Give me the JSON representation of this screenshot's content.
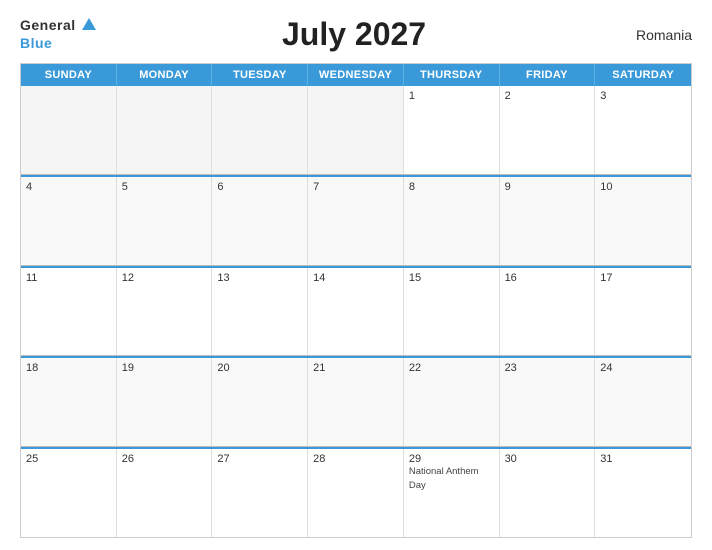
{
  "header": {
    "logo_general": "General",
    "logo_blue": "Blue",
    "title": "July 2027",
    "country": "Romania"
  },
  "calendar": {
    "days_of_week": [
      "Sunday",
      "Monday",
      "Tuesday",
      "Wednesday",
      "Thursday",
      "Friday",
      "Saturday"
    ],
    "weeks": [
      [
        {
          "day": "",
          "empty": true
        },
        {
          "day": "",
          "empty": true
        },
        {
          "day": "",
          "empty": true
        },
        {
          "day": "",
          "empty": true
        },
        {
          "day": "1",
          "empty": false,
          "event": ""
        },
        {
          "day": "2",
          "empty": false,
          "event": ""
        },
        {
          "day": "3",
          "empty": false,
          "event": ""
        }
      ],
      [
        {
          "day": "4",
          "empty": false,
          "event": ""
        },
        {
          "day": "5",
          "empty": false,
          "event": ""
        },
        {
          "day": "6",
          "empty": false,
          "event": ""
        },
        {
          "day": "7",
          "empty": false,
          "event": ""
        },
        {
          "day": "8",
          "empty": false,
          "event": ""
        },
        {
          "day": "9",
          "empty": false,
          "event": ""
        },
        {
          "day": "10",
          "empty": false,
          "event": ""
        }
      ],
      [
        {
          "day": "11",
          "empty": false,
          "event": ""
        },
        {
          "day": "12",
          "empty": false,
          "event": ""
        },
        {
          "day": "13",
          "empty": false,
          "event": ""
        },
        {
          "day": "14",
          "empty": false,
          "event": ""
        },
        {
          "day": "15",
          "empty": false,
          "event": ""
        },
        {
          "day": "16",
          "empty": false,
          "event": ""
        },
        {
          "day": "17",
          "empty": false,
          "event": ""
        }
      ],
      [
        {
          "day": "18",
          "empty": false,
          "event": ""
        },
        {
          "day": "19",
          "empty": false,
          "event": ""
        },
        {
          "day": "20",
          "empty": false,
          "event": ""
        },
        {
          "day": "21",
          "empty": false,
          "event": ""
        },
        {
          "day": "22",
          "empty": false,
          "event": ""
        },
        {
          "day": "23",
          "empty": false,
          "event": ""
        },
        {
          "day": "24",
          "empty": false,
          "event": ""
        }
      ],
      [
        {
          "day": "25",
          "empty": false,
          "event": ""
        },
        {
          "day": "26",
          "empty": false,
          "event": ""
        },
        {
          "day": "27",
          "empty": false,
          "event": ""
        },
        {
          "day": "28",
          "empty": false,
          "event": ""
        },
        {
          "day": "29",
          "empty": false,
          "event": "National Anthem Day"
        },
        {
          "day": "30",
          "empty": false,
          "event": ""
        },
        {
          "day": "31",
          "empty": false,
          "event": ""
        }
      ]
    ]
  }
}
